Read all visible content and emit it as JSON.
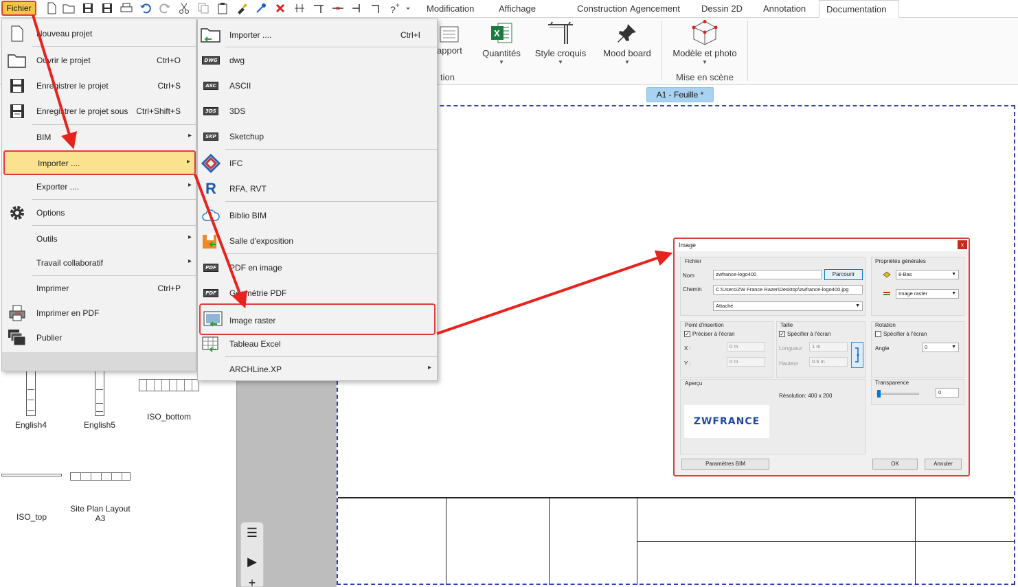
{
  "topbar": {
    "fichier_label": "Fichier",
    "tabs": [
      "Modification",
      "Affichage",
      "Construction",
      "Agencement",
      "Dessin 2D",
      "Annotation",
      "Documentation"
    ],
    "active_tab": "Documentation"
  },
  "ribbon": {
    "rapport_label": "apport",
    "tion_label": "tion",
    "buttons": [
      {
        "label": "Quantités",
        "icon": "excel-icon"
      },
      {
        "label": "Style croquis",
        "icon": "sketch-style-icon"
      },
      {
        "label": "Mood board",
        "icon": "pushpin-icon"
      },
      {
        "label": "Modèle et photo",
        "icon": "cube-model-icon"
      }
    ],
    "group_label": "Mise en scène"
  },
  "sheet_tab": "A1 - Feuille *",
  "library": {
    "items": [
      "English4",
      "English5",
      "ISO_bottom",
      "ISO_top",
      "Site Plan Layout A3"
    ]
  },
  "main_menu": {
    "items": [
      {
        "label": "Nouveau projet",
        "shortcut": "",
        "icon": "new-file-icon",
        "submenu": false
      },
      {
        "label": "Ouvrir le projet",
        "shortcut": "Ctrl+O",
        "icon": "open-folder-icon",
        "submenu": false
      },
      {
        "label": "Enregistrer le projet",
        "shortcut": "Ctrl+S",
        "icon": "save-icon",
        "submenu": false
      },
      {
        "label": "Enregistrer le projet sous",
        "shortcut": "Ctrl+Shift+S",
        "icon": "save-as-icon",
        "submenu": false
      },
      {
        "label": "BIM",
        "shortcut": "",
        "icon": "",
        "submenu": true
      },
      {
        "label": "Importer ....",
        "shortcut": "",
        "icon": "",
        "submenu": true
      },
      {
        "label": "Exporter ....",
        "shortcut": "",
        "icon": "",
        "submenu": true
      },
      {
        "label": "Options",
        "shortcut": "",
        "icon": "gear-icon",
        "submenu": false
      },
      {
        "label": "Outils",
        "shortcut": "",
        "icon": "",
        "submenu": true
      },
      {
        "label": "Travail collaboratif",
        "shortcut": "",
        "icon": "",
        "submenu": true
      },
      {
        "label": "Imprimer",
        "shortcut": "Ctrl+P",
        "icon": "",
        "submenu": false
      },
      {
        "label": "Imprimer en PDF",
        "shortcut": "",
        "icon": "print-pdf-icon",
        "submenu": false
      },
      {
        "label": "Publier",
        "shortcut": "",
        "icon": "publish-icon",
        "submenu": false
      }
    ]
  },
  "import_menu": {
    "items": [
      {
        "label": "Importer ....",
        "shortcut": "Ctrl+I",
        "badge": ""
      },
      {
        "label": "dwg",
        "shortcut": "",
        "badge": "DWG"
      },
      {
        "label": "ASCII",
        "shortcut": "",
        "badge": "ASC"
      },
      {
        "label": "3DS",
        "shortcut": "",
        "badge": "3DS"
      },
      {
        "label": "Sketchup",
        "shortcut": "",
        "badge": "SKP"
      },
      {
        "label": "IFC",
        "shortcut": "",
        "badge": ""
      },
      {
        "label": "RFA, RVT",
        "shortcut": "",
        "badge": "R"
      },
      {
        "label": "Biblio BIM",
        "shortcut": "",
        "badge": ""
      },
      {
        "label": "Salle d'exposition",
        "shortcut": "",
        "badge": ""
      },
      {
        "label": "PDF en image",
        "shortcut": "",
        "badge": "PDF"
      },
      {
        "label": "Géométrie PDF",
        "shortcut": "",
        "badge": "PDF"
      },
      {
        "label": "Image raster",
        "shortcut": "",
        "badge": ""
      },
      {
        "label": "Tableau Excel",
        "shortcut": "",
        "badge": ""
      },
      {
        "label": "ARCHLine.XP",
        "shortcut": "",
        "badge": ""
      }
    ]
  },
  "dialog": {
    "title": "Image",
    "close": "x",
    "fichier": {
      "label": "Fichier",
      "nom_label": "Nom",
      "nom_value": "zwfrance-logo400",
      "browse": "Parcourir",
      "chemin_label": "Chemin",
      "chemin_value": "C:\\Users\\ZW France Razer\\Desktop\\zwfrance-logo400.jpg",
      "mode": "Attaché"
    },
    "props": {
      "label": "Propriétés générales",
      "layer": "8-Bas",
      "type": "Image raster"
    },
    "insertion": {
      "label": "Point d'insertion",
      "check": "Préciser à l'écran",
      "x_label": "X :",
      "x_value": "0 m",
      "y_label": "Y :",
      "y_value": "0 m"
    },
    "taille": {
      "label": "Taille",
      "check": "Spécifier à l'écran",
      "longueur_label": "Longueur",
      "longueur_value": "1 m",
      "hauteur_label": "Hauteur",
      "hauteur_value": "0.5 m"
    },
    "rotation": {
      "label": "Rotation",
      "check": "Spécifier à l'écran",
      "angle_label": "Angle",
      "angle_value": "0"
    },
    "apercu": {
      "label": "Aperçu",
      "resolution": "Résolution: 400 x 200",
      "logo_text": "ZWFRANCE"
    },
    "transparence": {
      "label": "Transparence",
      "value": "0",
      "level": 0
    },
    "bim_button": "Paramètres BIM",
    "ok": "OK",
    "cancel": "Annuler"
  },
  "colors": {
    "highlight_border": "#e23b3b",
    "fichier_bg": "#f6c445",
    "sheet_border": "#2e3fb5",
    "sheet_tab": "#a9d2f0"
  }
}
